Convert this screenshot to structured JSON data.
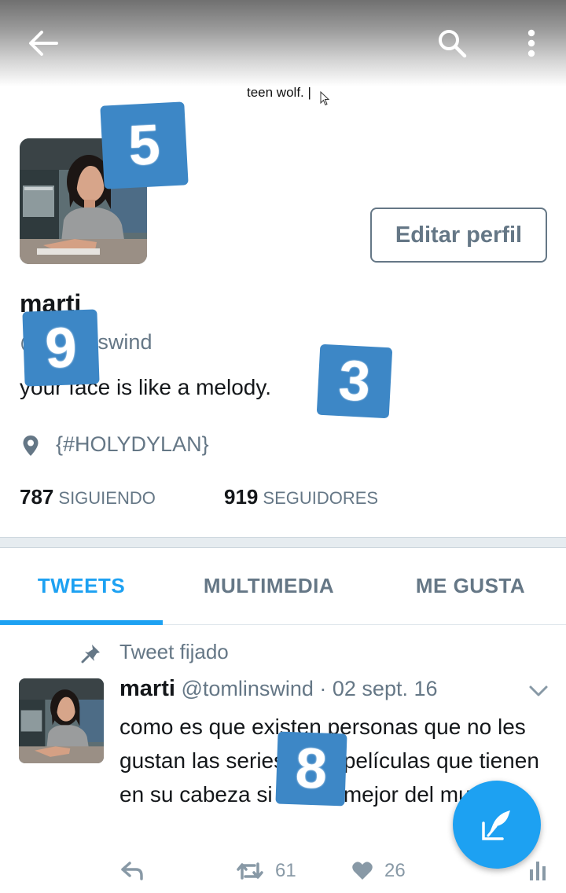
{
  "header": {
    "back_icon": "arrow-left-icon",
    "search_icon": "search-icon",
    "more_icon": "more-vertical-icon"
  },
  "banner": {
    "text": "teen wolf. |"
  },
  "profile": {
    "edit_button": "Editar perfil",
    "name": "marti",
    "handle": "@tomlinswind",
    "bio": "your face is like a melody.",
    "location": "{#HOLYDYLAN}",
    "following_count": "787",
    "following_label": "SIGUIENDO",
    "followers_count": "919",
    "followers_label": "SEGUIDORES"
  },
  "tabs": [
    {
      "label": "TWEETS",
      "active": true
    },
    {
      "label": "MULTIMEDIA",
      "active": false
    },
    {
      "label": "ME GUSTA",
      "active": false
    }
  ],
  "pinned_tweet": {
    "pinned_label": "Tweet fijado",
    "author_name": "marti",
    "meta": "@tomlinswind · 02 sept. 16",
    "text": "como es que existen personas que no les gustan las series o las películas que tienen en su cabeza si son lo mejor del mundo",
    "retweets": "61",
    "likes": "26"
  },
  "badges": [
    "5",
    "9",
    "3",
    "8"
  ],
  "colors": {
    "accent": "#1da1f2",
    "secondary_text": "#657786",
    "badge": "#3d87c6"
  }
}
